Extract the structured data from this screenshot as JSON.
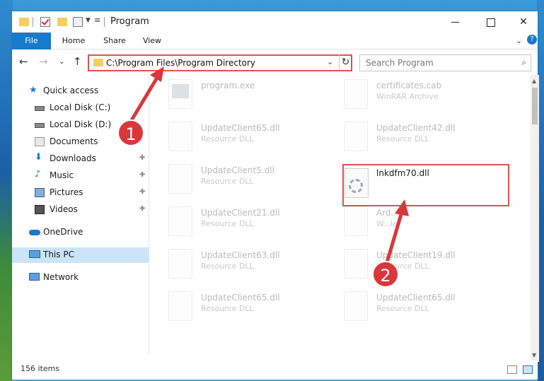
{
  "window": {
    "title": "Program"
  },
  "ribbon": {
    "tabs": [
      "File",
      "Home",
      "Share",
      "View"
    ],
    "chevron": "⌄",
    "help": "?"
  },
  "nav": {
    "back": "←",
    "forward": "→",
    "recent": "⌄",
    "up": "↑"
  },
  "address": {
    "path": "C:\\Program Files\\Program Directory"
  },
  "search": {
    "placeholder": "Search Program"
  },
  "sidebar": {
    "items": [
      {
        "label": "Quick access",
        "icon": "star-icon"
      },
      {
        "label": "Local Disk (C:)",
        "icon": "drive-icon"
      },
      {
        "label": "Local Disk (D:)",
        "icon": "drive-icon"
      },
      {
        "label": "Documents",
        "icon": "documents-icon"
      },
      {
        "label": "Downloads",
        "icon": "download-icon"
      },
      {
        "label": "Music",
        "icon": "music-icon"
      },
      {
        "label": "Pictures",
        "icon": "pictures-icon"
      },
      {
        "label": "Videos",
        "icon": "videos-icon"
      },
      {
        "label": "OneDrive",
        "icon": "cloud-icon"
      },
      {
        "label": "This PC",
        "icon": "computer-icon"
      },
      {
        "label": "Network",
        "icon": "network-icon"
      }
    ]
  },
  "files": [
    {
      "name": "program.exe",
      "type": "",
      "icon": "exe-icon"
    },
    {
      "name": "certificates.cab",
      "type": "WinRAR Archive",
      "icon": "archive-icon"
    },
    {
      "name": "UpdateClient65.dll",
      "type": "Resource DLL",
      "icon": "dll-icon"
    },
    {
      "name": "UpdateClient42.dll",
      "type": "Resource DLL",
      "icon": "dll-icon"
    },
    {
      "name": "UpdateClient5.dll",
      "type": "Resource DLL",
      "icon": "dll-icon"
    },
    {
      "name": "lnkdfm70.dll",
      "type": "",
      "icon": "dll-icon"
    },
    {
      "name": "UpdateClient21.dll",
      "type": "Resource DLL",
      "icon": "dll-icon"
    },
    {
      "name": "Ard...rd",
      "type": "W...le",
      "icon": "file-icon"
    },
    {
      "name": "UpdateClient63.dll",
      "type": "Resource DLL",
      "icon": "dll-icon"
    },
    {
      "name": "UpdateClient19.dll",
      "type": "Resource DLL",
      "icon": "dll-icon"
    },
    {
      "name": "UpdateClient65.dll",
      "type": "Resource DLL",
      "icon": "dll-icon"
    },
    {
      "name": "UpdateClient65.dll",
      "type": "Resource DLL",
      "icon": "dll-icon"
    }
  ],
  "status": {
    "count": "156 items"
  },
  "markers": [
    "1",
    "2"
  ],
  "colors": {
    "accent": "#1979ca",
    "highlight": "#d9534f",
    "marker": "#d9373a"
  }
}
